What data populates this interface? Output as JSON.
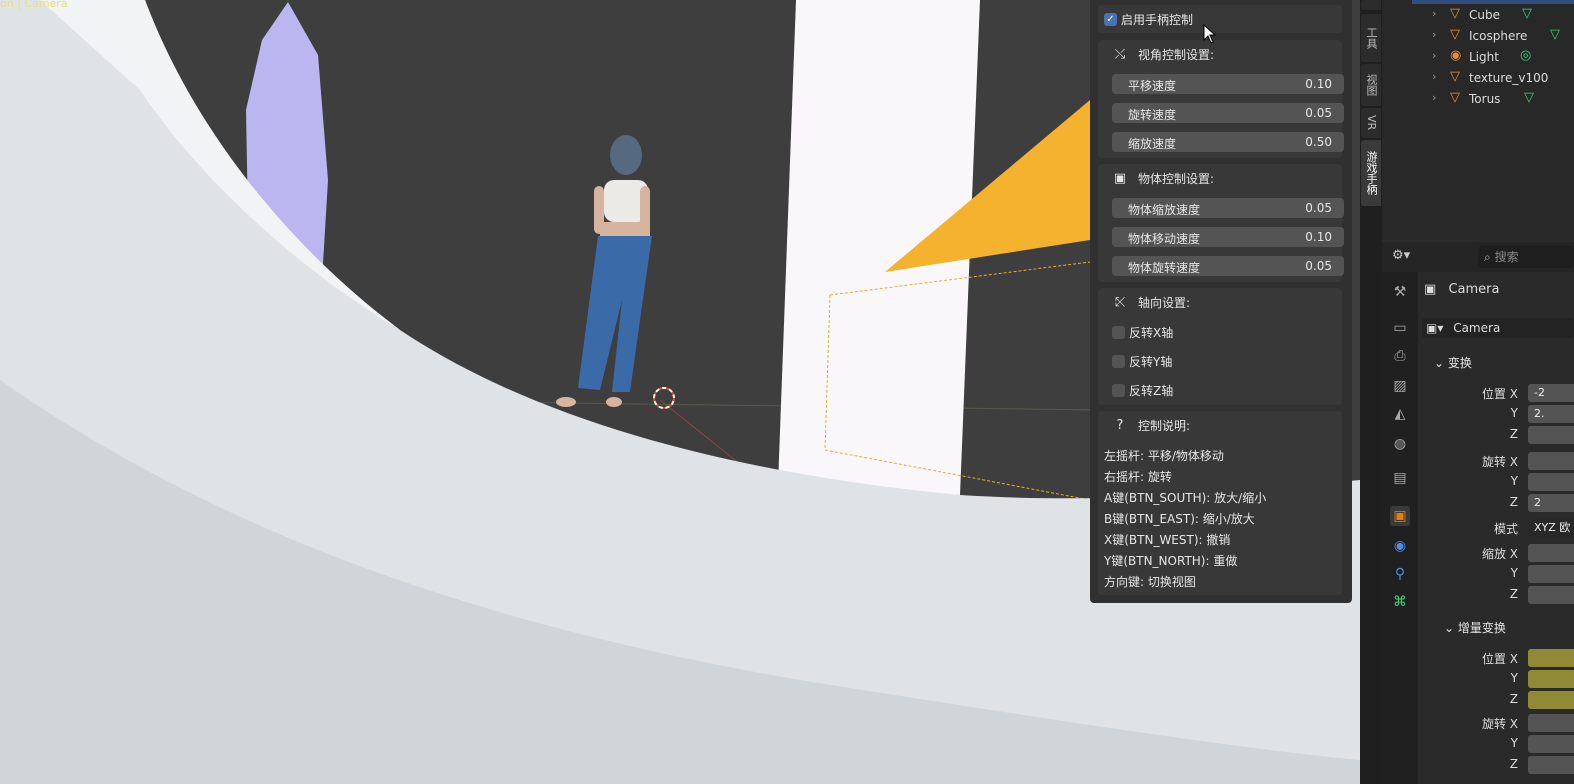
{
  "viewport": {
    "overlay_label": "on | Camera"
  },
  "npanel": {
    "enable": {
      "label": "启用手柄控制",
      "checked": true
    },
    "view_section": {
      "title": "视角控制设置:",
      "sliders": [
        {
          "label": "平移速度",
          "value": "0.10"
        },
        {
          "label": "旋转速度",
          "value": "0.05"
        },
        {
          "label": "缩放速度",
          "value": "0.50"
        }
      ]
    },
    "object_section": {
      "title": "物体控制设置:",
      "sliders": [
        {
          "label": "物体缩放速度",
          "value": "0.05"
        },
        {
          "label": "物体移动速度",
          "value": "0.10"
        },
        {
          "label": "物体旋转速度",
          "value": "0.05"
        }
      ]
    },
    "axis_section": {
      "title": "轴向设置:",
      "checks": [
        {
          "label": "反转X轴",
          "checked": false
        },
        {
          "label": "反转Y轴",
          "checked": false
        },
        {
          "label": "反转Z轴",
          "checked": false
        }
      ]
    },
    "help_section": {
      "title": "控制说明:",
      "lines": [
        "左摇杆: 平移/物体移动",
        "右摇杆: 旋转",
        "A键(BTN_SOUTH): 放大/缩小",
        "B键(BTN_EAST): 缩小/放大",
        "X键(BTN_WEST): 撤销",
        "Y键(BTN_NORTH): 重做",
        "方向键: 切换视图"
      ]
    }
  },
  "vtabs": [
    "工具",
    "视图",
    "VR",
    "游戏手柄"
  ],
  "outliner": {
    "items": [
      {
        "name": "Cube"
      },
      {
        "name": "Icosphere"
      },
      {
        "name": "Light"
      },
      {
        "name": "texture_v100"
      },
      {
        "name": "Torus"
      }
    ]
  },
  "properties": {
    "search_placeholder": "搜索",
    "object_name": "Camera",
    "data_name": "Camera",
    "transform_title": "变换",
    "location_x_label": "位置 X",
    "location_x_value": "-2",
    "location_y_value": "2.",
    "y_label": "Y",
    "z_label": "Z",
    "rotation_x_label": "旋转 X",
    "rotation_z_value": "2",
    "mode_label": "模式",
    "mode_value": "XYZ 欧",
    "scale_x_label": "缩放 X",
    "delta_title": "增量变换",
    "delta_location_x_label": "位置 X",
    "delta_rotation_x_label": "旋转 X"
  },
  "colors": {
    "accent_blue": "#4772b3",
    "orange": "#f4b22e",
    "purple": "#bcb6f0",
    "delta_yellow": "#8f8a33"
  }
}
